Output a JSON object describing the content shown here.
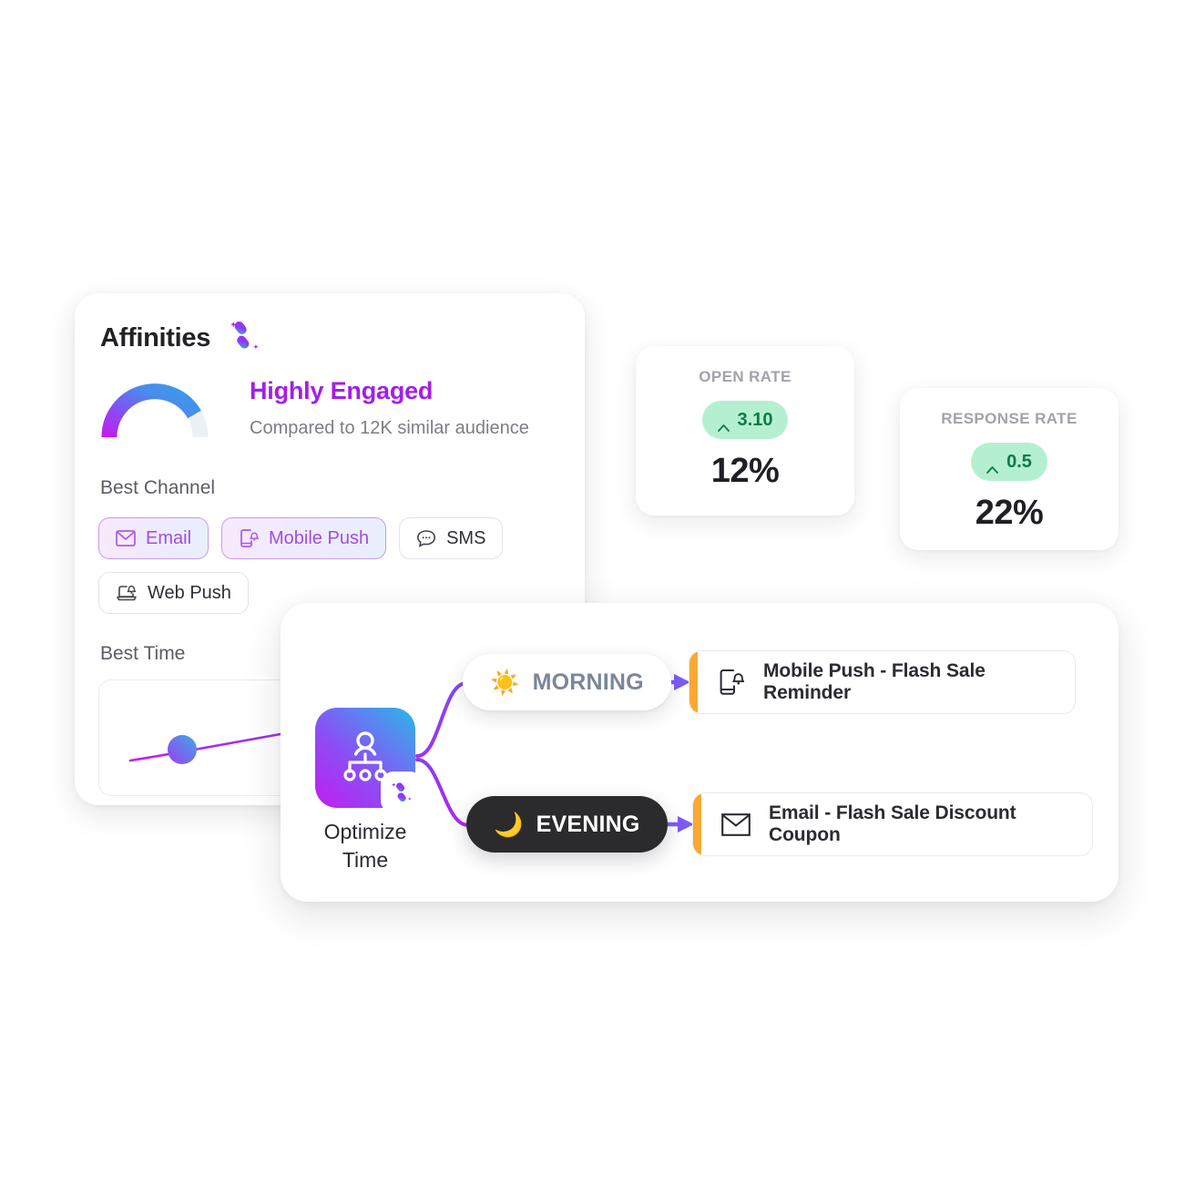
{
  "affinities": {
    "title": "Affinities",
    "logo_icon": "ai-sparkle-icon",
    "gauge": {
      "value_pct": 80,
      "track_color": "#eef1f4"
    },
    "engagement_title": "Highly Engaged",
    "engagement_title_color": "#a31ee8",
    "engagement_sub": "Compared to 12K similar audience",
    "best_channel_label": "Best Channel",
    "channels": [
      {
        "label": "Email",
        "icon": "envelope-icon",
        "active": true
      },
      {
        "label": "Mobile Push",
        "icon": "mobile-bell-icon",
        "active": true
      },
      {
        "label": "SMS",
        "icon": "chat-bubble-icon",
        "active": false
      },
      {
        "label": "Web Push",
        "icon": "laptop-bell-icon",
        "active": false
      }
    ],
    "best_time_label": "Best Time",
    "best_time_chart": {
      "marker_label": "",
      "line_color_start": "#c21ef0",
      "line_color_end": "#4a5df0"
    }
  },
  "kpis": [
    {
      "label": "OPEN RATE",
      "delta": "3.10",
      "delta_direction": "up",
      "delta_icon": "caret-up-icon",
      "value": "12%",
      "pill_bg": "#b4f0cf",
      "pill_fg": "#0c7a46"
    },
    {
      "label": "RESPONSE RATE",
      "delta": "0.5",
      "delta_direction": "up",
      "delta_icon": "caret-up-icon",
      "value": "22%",
      "pill_bg": "#b4f0cf",
      "pill_fg": "#0c7a46"
    }
  ],
  "flow": {
    "source": {
      "caption_line1": "Optimize",
      "caption_line2": "Time",
      "icon": "audience-tree-icon",
      "badge_icon": "ai-sparkle-icon"
    },
    "branches": [
      {
        "pill_label": "MORNING",
        "pill_emoji": "☀️",
        "pill_emoji_name": "sun-emoji",
        "theme": "light",
        "message_icon": "mobile-bell-icon",
        "message_label": "Mobile Push - Flash Sale Reminder",
        "accent_color": "#f9a832"
      },
      {
        "pill_label": "EVENING",
        "pill_emoji": "🌙",
        "pill_emoji_name": "crescent-moon-emoji",
        "theme": "dark",
        "message_icon": "envelope-icon",
        "message_label": "Email - Flash Sale Discount Coupon",
        "accent_color": "#f9a832"
      }
    ],
    "connector_color": "#8b3cf0",
    "arrow_color": "#7c5cf5"
  }
}
